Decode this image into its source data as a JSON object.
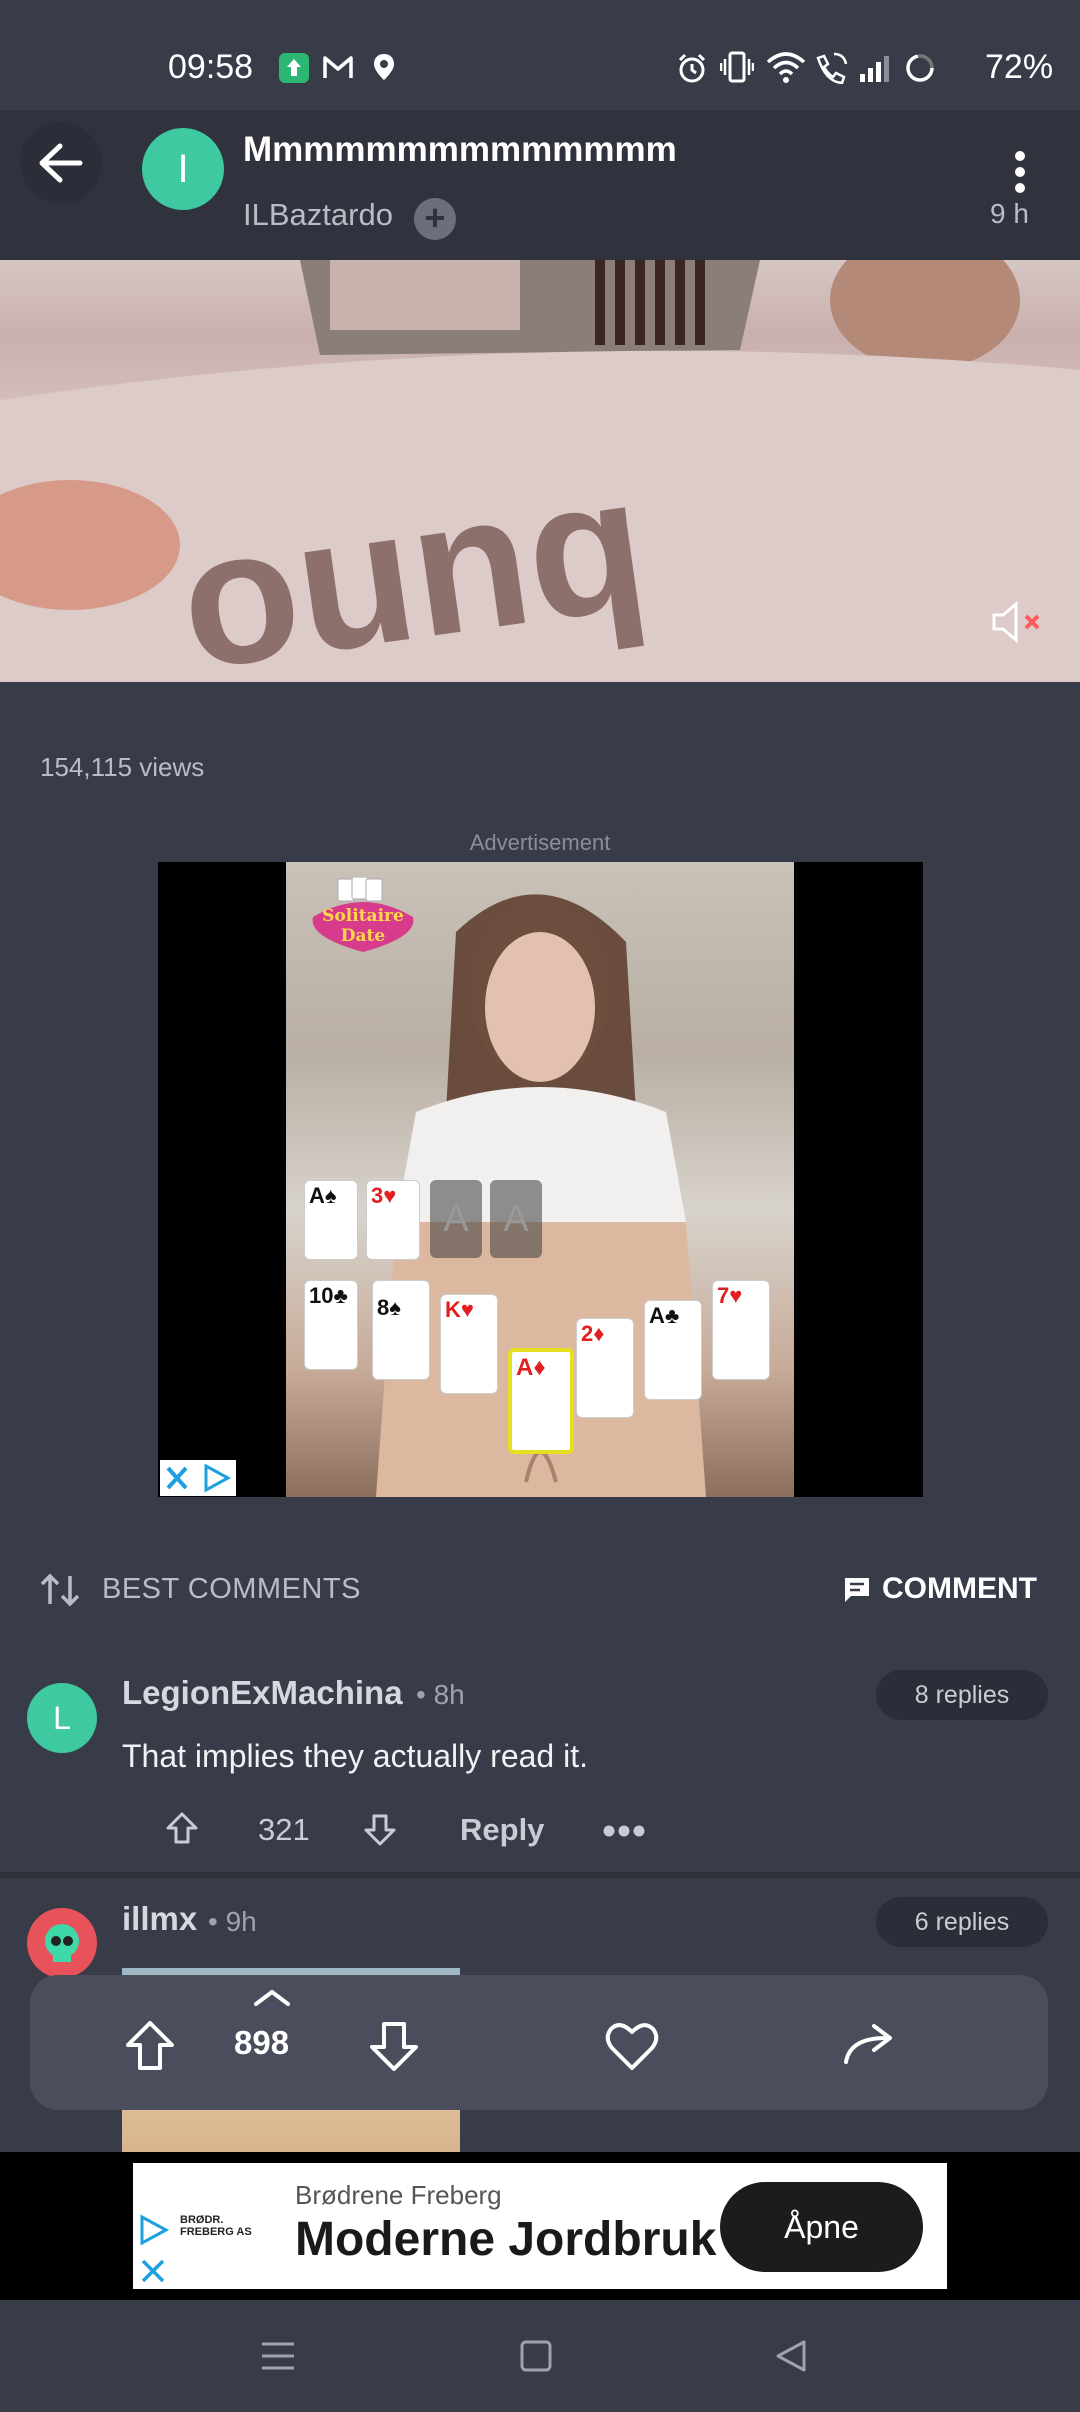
{
  "status_bar": {
    "time": "09:58",
    "battery": "72%",
    "icons": [
      "app-update-icon",
      "gmail-icon",
      "location-icon",
      "alarm-icon",
      "vibrate-icon",
      "wifi-icon",
      "wifi-calling-icon",
      "signal-icon",
      "battery-icon"
    ]
  },
  "post": {
    "title": "Mmmmmmmmmmmmmm",
    "avatar_letter": "I",
    "username": "ILBaztardo",
    "age": "9 h",
    "views": "154,115 views"
  },
  "ad": {
    "label": "Advertisement",
    "game_logo_line1": "Solitaire",
    "game_logo_line2": "Date",
    "cards": [
      "A♠",
      "3♥",
      "A",
      "A",
      "10♣",
      "8♠",
      "K♥",
      "A♦",
      "2♦",
      "A♣",
      "7♥"
    ]
  },
  "comments_section": {
    "sort_label": "BEST COMMENTS",
    "comment_button": "COMMENT"
  },
  "comments": [
    {
      "avatar_letter": "L",
      "username": "LegionExMachina",
      "age": "• 8h",
      "replies": "8 replies",
      "text": "That implies they actually read it.",
      "score": "321",
      "reply_label": "Reply"
    },
    {
      "username": "illmx",
      "age": "• 9h",
      "replies": "6 replies"
    }
  ],
  "vote_bar": {
    "score": "898"
  },
  "bottom_ad": {
    "advertiser": "Brødrene Freberg",
    "headline": "Moderne Jordbruk",
    "cta": "Åpne",
    "logo_line1": "BRØDR.",
    "logo_line2": "FREBERG AS"
  },
  "colors": {
    "background": "#383c49",
    "header": "#30333e",
    "accent_green": "#3fc9a0",
    "vote_bar": "#4a4e5c"
  }
}
